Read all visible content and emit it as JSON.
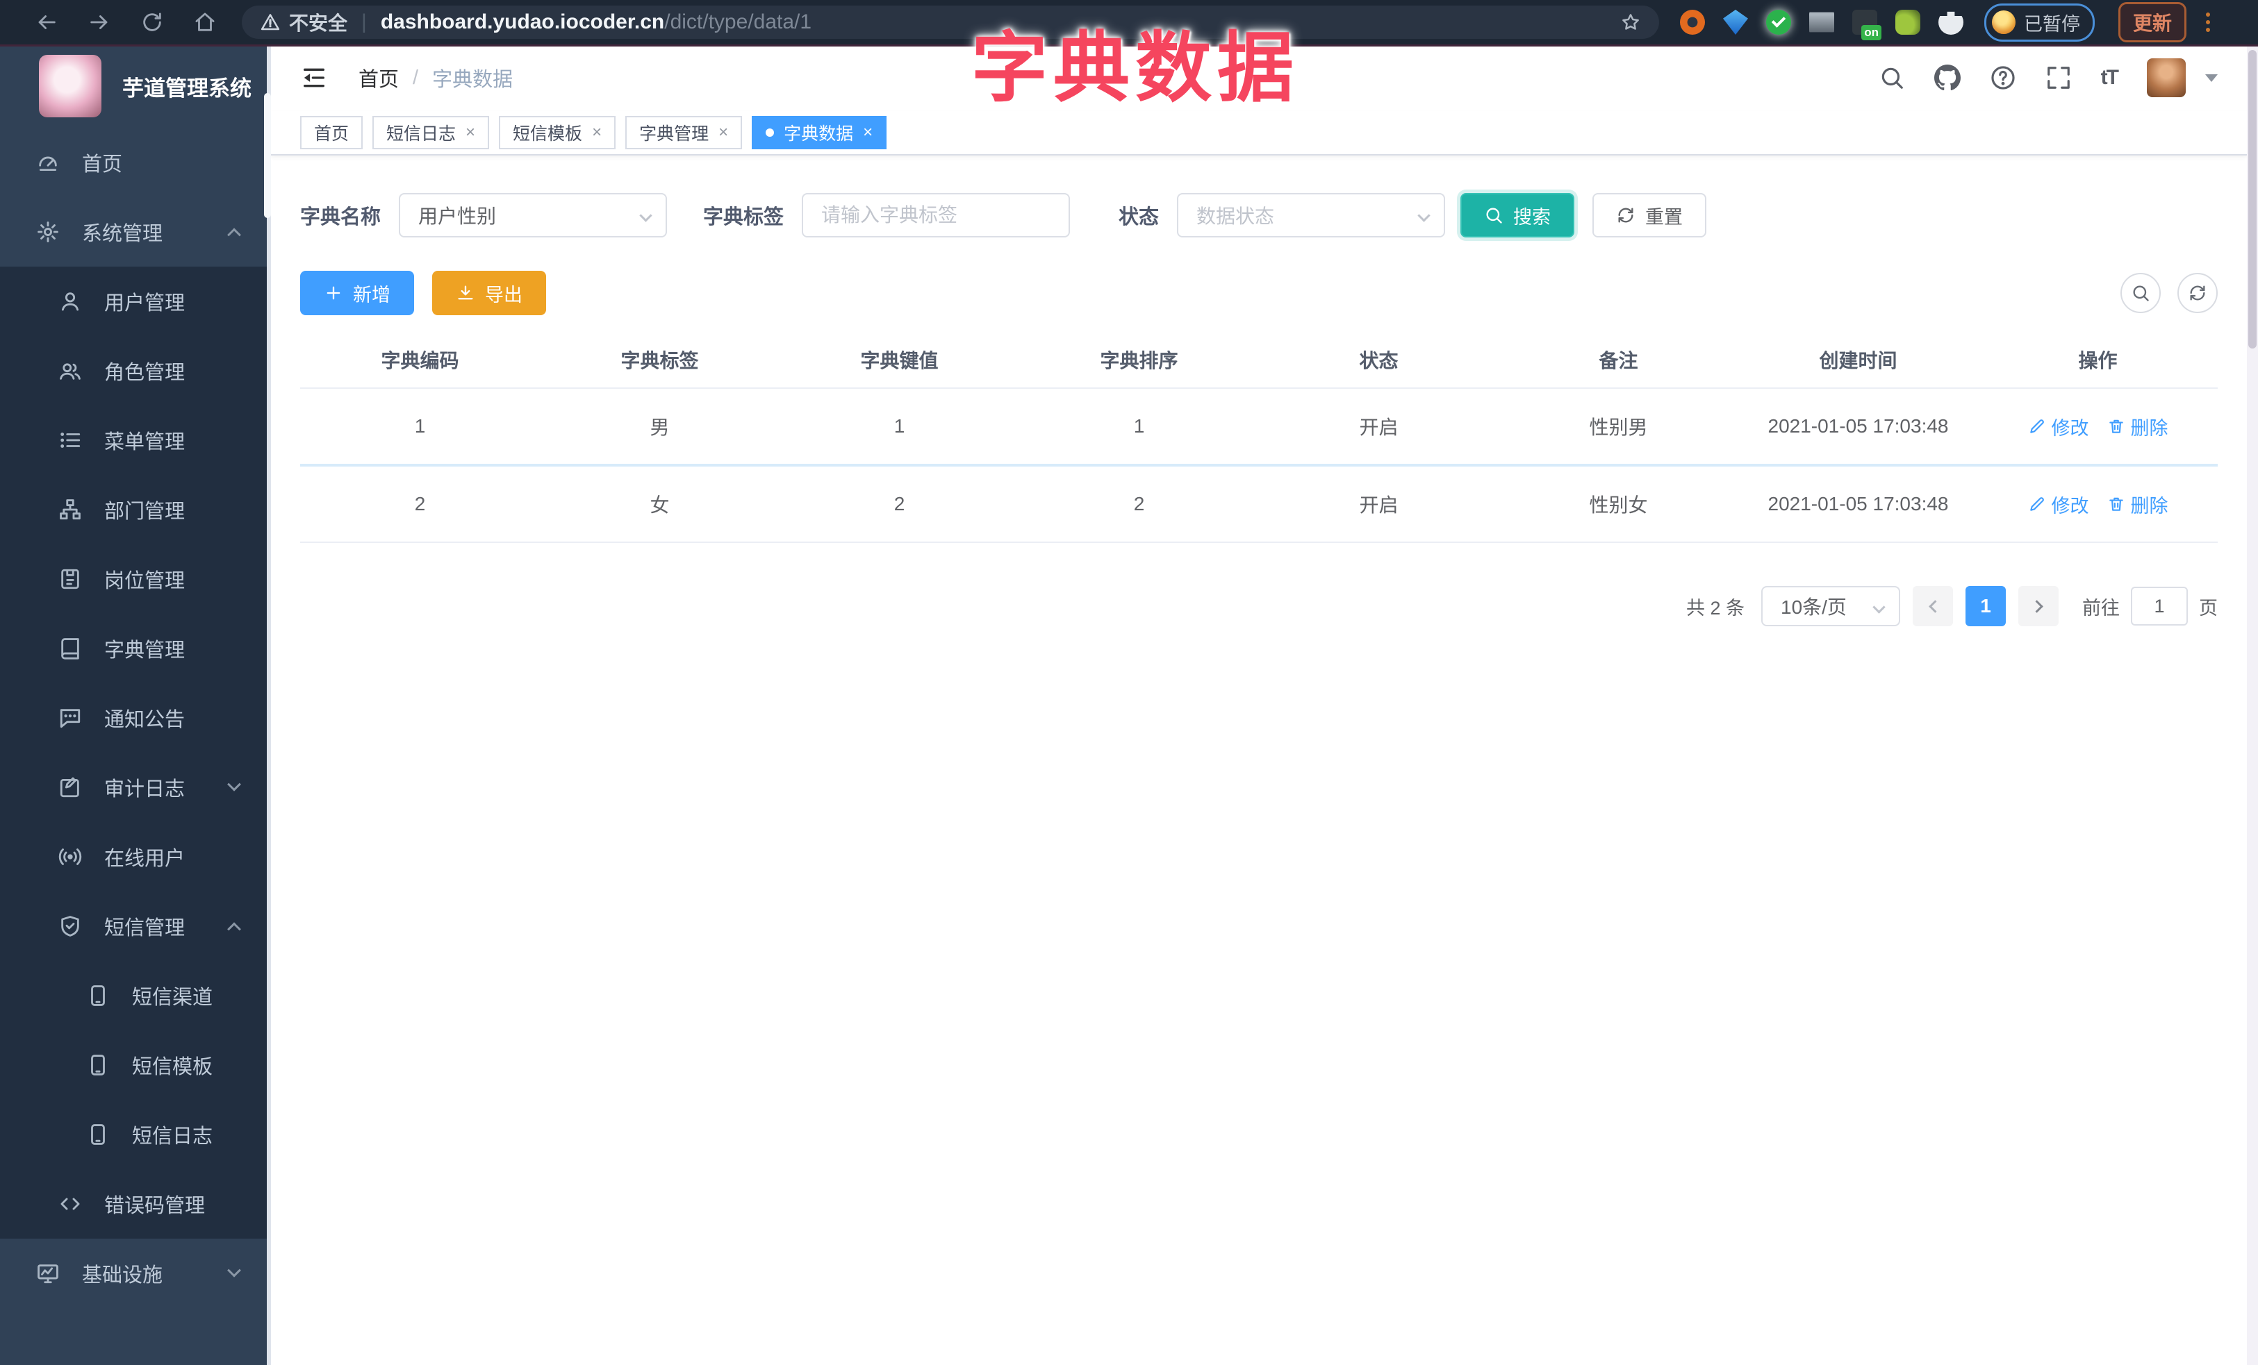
{
  "overlay_title": "字典数据",
  "icons": {
    "close": "×",
    "font_size": "tT",
    "question_mark": "?"
  },
  "browser": {
    "security_text": "不安全",
    "separator": "|",
    "url_host": "dashboard.yudao.iocoder.cn",
    "url_path": "/dict/type/data/1",
    "paused_label": "已暂停",
    "update_label": "更新"
  },
  "sidebar": {
    "logo_title": "芋道管理系统",
    "items": [
      {
        "label": "首页"
      },
      {
        "label": "系统管理"
      },
      {
        "label": "用户管理"
      },
      {
        "label": "角色管理"
      },
      {
        "label": "菜单管理"
      },
      {
        "label": "部门管理"
      },
      {
        "label": "岗位管理"
      },
      {
        "label": "字典管理"
      },
      {
        "label": "通知公告"
      },
      {
        "label": "审计日志"
      },
      {
        "label": "在线用户"
      },
      {
        "label": "短信管理"
      },
      {
        "label": "短信渠道"
      },
      {
        "label": "短信模板"
      },
      {
        "label": "短信日志"
      },
      {
        "label": "错误码管理"
      },
      {
        "label": "基础设施"
      }
    ]
  },
  "header": {
    "breadcrumb_home": "首页",
    "breadcrumb_sep": "/",
    "breadcrumb_current": "字典数据"
  },
  "tabs": {
    "items": [
      "首页",
      "短信日志",
      "短信模板",
      "字典管理",
      "字典数据"
    ]
  },
  "filters": {
    "name_label": "字典名称",
    "name_value": "用户性别",
    "tag_label": "字典标签",
    "tag_placeholder": "请输入字典标签",
    "status_label": "状态",
    "status_placeholder": "数据状态",
    "search_label": "搜索",
    "reset_label": "重置"
  },
  "toolbar": {
    "add_label": "新增",
    "export_label": "导出"
  },
  "table": {
    "headers": [
      "字典编码",
      "字典标签",
      "字典键值",
      "字典排序",
      "状态",
      "备注",
      "创建时间",
      "操作"
    ],
    "rows": [
      {
        "code": "1",
        "label": "男",
        "value": "1",
        "sort": "1",
        "status": "开启",
        "remark": "性别男",
        "created": "2021-01-05 17:03:48"
      },
      {
        "code": "2",
        "label": "女",
        "value": "2",
        "sort": "2",
        "status": "开启",
        "remark": "性别女",
        "created": "2021-01-05 17:03:48"
      }
    ],
    "edit_label": "修改",
    "delete_label": "删除"
  },
  "pagination": {
    "total": "共 2 条",
    "page_size": "10条/页",
    "page": "1",
    "goto_label": "前往",
    "goto_value": "1",
    "unit_label": "页"
  },
  "colors": {
    "primary": "#409EFF",
    "warning": "#EEA223",
    "teal": "#1DB3A6",
    "title_red": "#F5455E",
    "sidebar": "#304156",
    "sidebar_sub": "#212E40"
  }
}
